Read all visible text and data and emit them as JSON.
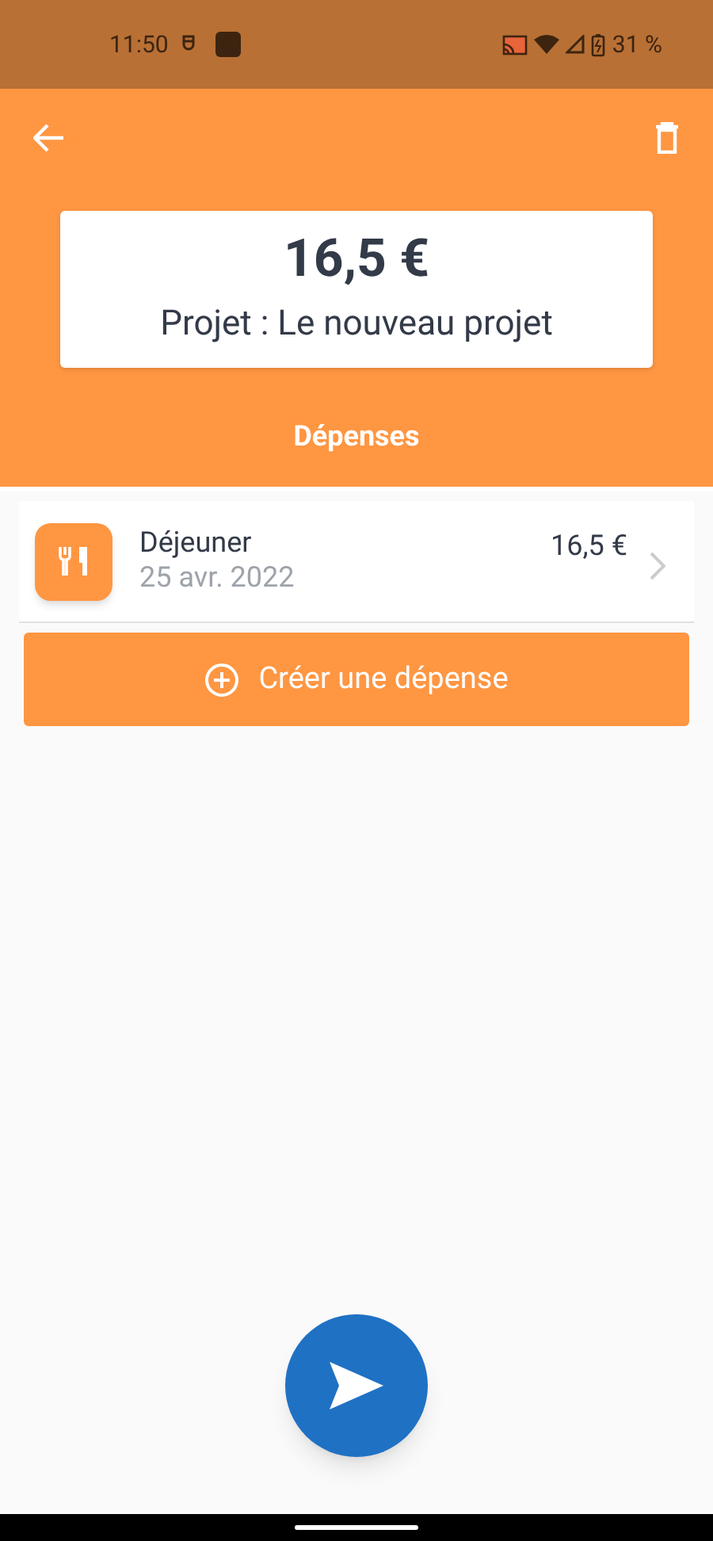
{
  "status_bar": {
    "time": "11:50",
    "battery": "31 %"
  },
  "header": {
    "total": "16,5 €",
    "project": "Projet : Le nouveau projet",
    "section_title": "Dépenses"
  },
  "expenses": [
    {
      "title": "Déjeuner",
      "date": "25 avr. 2022",
      "amount": "16,5 €"
    }
  ],
  "create_button": {
    "label": "Créer une dépense"
  }
}
